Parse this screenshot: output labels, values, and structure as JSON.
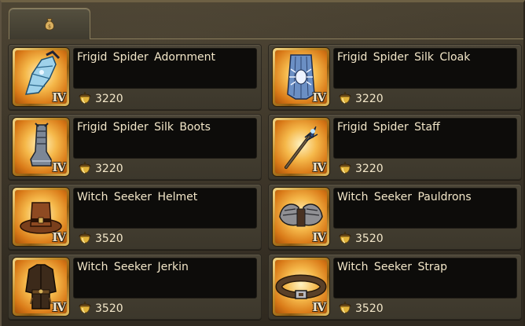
{
  "tab": {
    "icon": "money-bag-icon"
  },
  "colors": {
    "name_text": "#f2e6c8",
    "name_box": "#0d0c0a",
    "card": "#443e31",
    "icon_frame_gold": "#c48c28",
    "icon_bg_orange": "#f5b84a",
    "acorn_gold": "#e0b23a"
  },
  "items": [
    {
      "name": "Frigid Spider Adornment",
      "price": "3220",
      "tier": "IV",
      "icon": "frost-spider-adornment-icon"
    },
    {
      "name": "Frigid Spider Silk Cloak",
      "price": "3220",
      "tier": "IV",
      "icon": "spider-silk-cloak-icon"
    },
    {
      "name": "Frigid Spider Silk Boots",
      "price": "3220",
      "tier": "IV",
      "icon": "spider-silk-boots-icon"
    },
    {
      "name": "Frigid Spider Staff",
      "price": "3220",
      "tier": "IV",
      "icon": "spider-staff-icon"
    },
    {
      "name": "Witch Seeker Helmet",
      "price": "3520",
      "tier": "IV",
      "icon": "witch-seeker-hat-icon"
    },
    {
      "name": "Witch Seeker Pauldrons",
      "price": "3520",
      "tier": "IV",
      "icon": "pauldrons-icon"
    },
    {
      "name": "Witch Seeker Jerkin",
      "price": "3520",
      "tier": "IV",
      "icon": "jerkin-icon"
    },
    {
      "name": "Witch Seeker Strap",
      "price": "3520",
      "tier": "IV",
      "icon": "belt-strap-icon"
    }
  ],
  "currency_icon": "acorn-currency-icon"
}
